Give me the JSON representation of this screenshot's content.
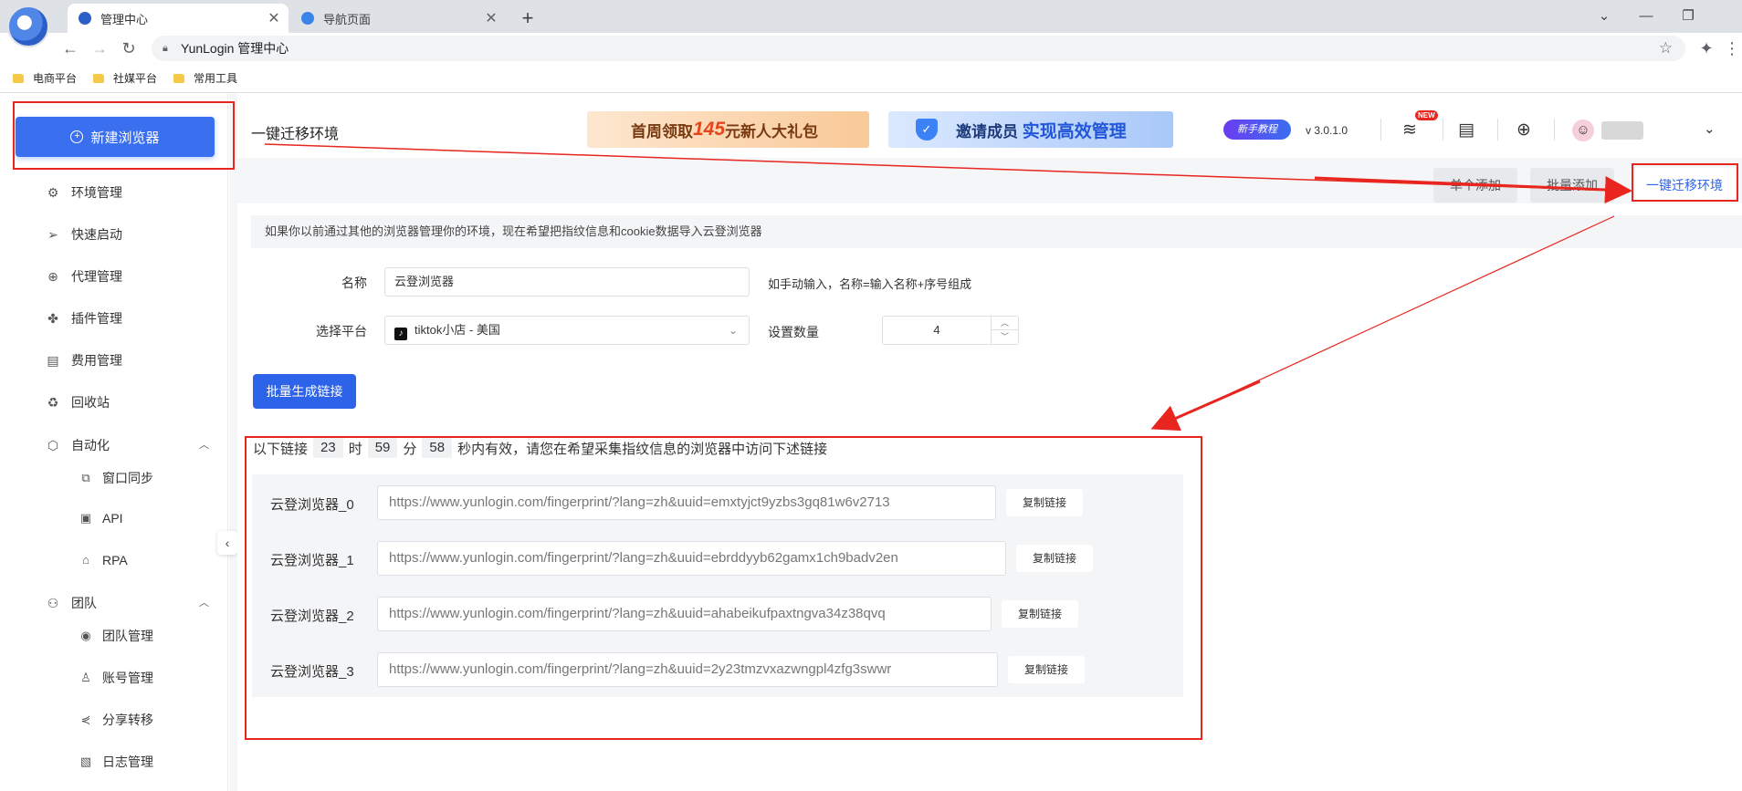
{
  "browser": {
    "tabs": [
      {
        "title": "管理中心",
        "active": true
      },
      {
        "title": "导航页面",
        "active": false
      }
    ],
    "address": "YunLogin 管理中心",
    "bookmarks": [
      "电商平台",
      "社媒平台",
      "常用工具"
    ]
  },
  "sidebar": {
    "new_browser": "新建浏览器",
    "items": [
      {
        "label": "环境管理",
        "icon": "env-icon"
      },
      {
        "label": "快速启动",
        "icon": "paper-plane-icon"
      },
      {
        "label": "代理管理",
        "icon": "globe-icon"
      },
      {
        "label": "插件管理",
        "icon": "puzzle-icon"
      },
      {
        "label": "费用管理",
        "icon": "billing-icon"
      },
      {
        "label": "回收站",
        "icon": "recycle-icon"
      }
    ],
    "automation": {
      "label": "自动化",
      "children": [
        "窗口同步",
        "API",
        "RPA"
      ]
    },
    "team": {
      "label": "团队",
      "children": [
        "团队管理",
        "账号管理",
        "分享转移",
        "日志管理"
      ]
    }
  },
  "header": {
    "title": "一键迁移环境",
    "banner1": {
      "pre": "首周领取",
      "amount": "145",
      "post": "元新人大礼包"
    },
    "banner2": {
      "pre": "邀请成员",
      "highlight": "实现高效管理"
    },
    "tutorial": "新手教程",
    "version": "v 3.0.1.0",
    "new_badge": "NEW"
  },
  "actions": {
    "single_add": "单个添加",
    "batch_add": "批量添加",
    "migrate": "一键迁移环境"
  },
  "form": {
    "info": "如果你以前通过其他的浏览器管理你的环境，现在希望把指纹信息和cookie数据导入云登浏览器",
    "name_label": "名称",
    "name_value": "云登浏览器",
    "name_hint": "如手动输入，名称=输入名称+序号组成",
    "platform_label": "选择平台",
    "platform_value": "tiktok小店 - 美国",
    "count_label": "设置数量",
    "count_value": "4",
    "generate": "批量生成链接"
  },
  "timer": {
    "prefix": "以下链接",
    "hours": "23",
    "h_unit": "时",
    "minutes": "59",
    "m_unit": "分",
    "seconds": "58",
    "suffix": "秒内有效，请您在希望采集指纹信息的浏览器中访问下述链接"
  },
  "links": [
    {
      "name": "云登浏览器_0",
      "url": "https://www.yunlogin.com/fingerprint/?lang=zh&uuid=emxtyjct9yzbs3gq81w6v2713",
      "copy": "复制链接"
    },
    {
      "name": "云登浏览器_1",
      "url": "https://www.yunlogin.com/fingerprint/?lang=zh&uuid=ebrddyyb62gamx1ch9badv2en",
      "copy": "复制链接"
    },
    {
      "name": "云登浏览器_2",
      "url": "https://www.yunlogin.com/fingerprint/?lang=zh&uuid=ahabeikufpaxtngva34z38qvq",
      "copy": "复制链接"
    },
    {
      "name": "云登浏览器_3",
      "url": "https://www.yunlogin.com/fingerprint/?lang=zh&uuid=2y23tmzvxazwngpl4zfg3swwr",
      "copy": "复制链接"
    }
  ],
  "colors": {
    "accent": "#2d63e8",
    "annotation": "#e8261f"
  }
}
